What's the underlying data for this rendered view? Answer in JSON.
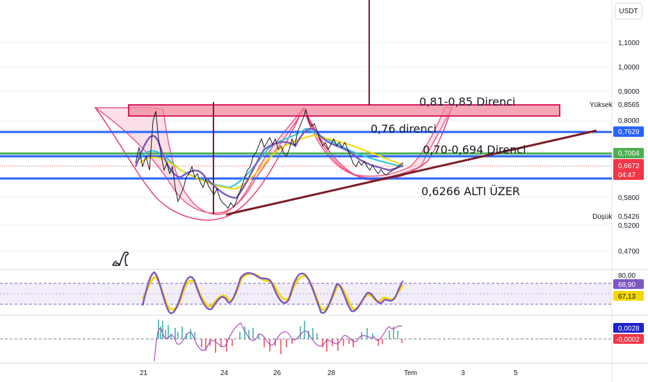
{
  "currency": "USDT",
  "price_scale": [
    "1,1000",
    "1,0000",
    "0,9000",
    "0,8000",
    "0,5800",
    "0,5200",
    "0,4700"
  ],
  "high": {
    "label": "Yüksek",
    "value": "0,8565"
  },
  "low": {
    "label": "Düşük",
    "value": "0,5426"
  },
  "price_tags": {
    "blue_top": "0,7629",
    "green": "0,7004",
    "current": "0,6672",
    "countdown": "04:47"
  },
  "annotations": {
    "resistance_zone": "0,81-0,85 Direnci",
    "resistance_076": "0,76 direnci",
    "resistance_070": "0,70-0,694 Direnci",
    "support_label": "0,6266 ALTI ÜZER"
  },
  "rsi": {
    "scale_top": "80,00",
    "value": "68,90",
    "ma_value": "67,13"
  },
  "macd": {
    "value": "0,0028",
    "signal": "-0,0002"
  },
  "time_axis": [
    "21",
    "24",
    "26",
    "28",
    "Tem",
    "3",
    "5"
  ],
  "colors": {
    "blue": "#2962ff",
    "green": "#4caf50",
    "red": "#f23645",
    "maroon": "#7b1c24",
    "purple": "#7e57c2",
    "yellow": "#f5d800",
    "pink_fill": "#f8c8d4"
  },
  "icons": [
    "dino-logo-icon"
  ]
}
